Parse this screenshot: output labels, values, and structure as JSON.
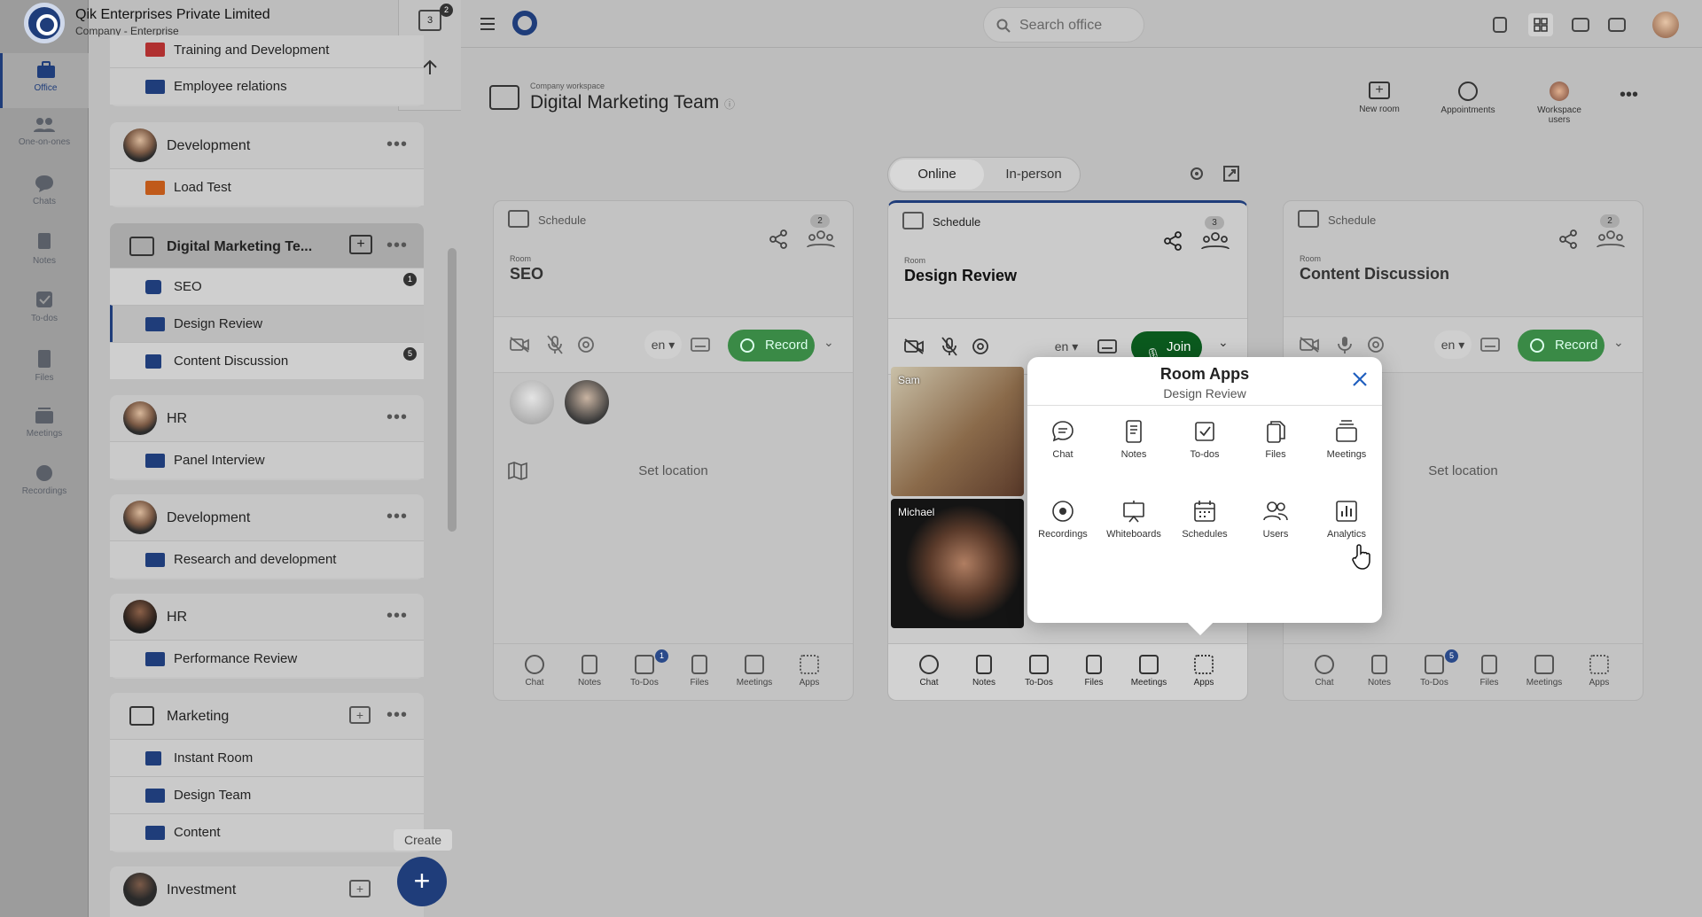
{
  "company": {
    "name": "Qik Enterprises Private Limited",
    "subtitle": "Company - Enterprise"
  },
  "rail": [
    {
      "label": "Office",
      "icon": "briefcase-icon",
      "active": true
    },
    {
      "label": "One-on-ones",
      "icon": "people-icon"
    },
    {
      "label": "Chats",
      "icon": "chat-icon"
    },
    {
      "label": "Notes",
      "icon": "notes-icon"
    },
    {
      "label": "To-dos",
      "icon": "todo-icon"
    },
    {
      "label": "Files",
      "icon": "files-icon"
    },
    {
      "label": "Meetings",
      "icon": "meetings-icon"
    },
    {
      "label": "Recordings",
      "icon": "recordings-icon"
    }
  ],
  "calendar": {
    "day": "3",
    "badge": "2"
  },
  "search": {
    "placeholder": "Search office"
  },
  "sidebar": {
    "groups": [
      {
        "rows": [
          "Training and Development",
          "Employee relations"
        ]
      },
      {
        "title": "Development",
        "rows": [
          "Load Test"
        ]
      },
      {
        "title": "Digital Marketing Te...",
        "rows": [
          "SEO",
          "Design Review",
          "Content Discussion"
        ]
      },
      {
        "title": "HR",
        "rows": [
          "Panel Interview"
        ]
      },
      {
        "title": "Development",
        "rows": [
          "Research and development"
        ]
      },
      {
        "title": "HR",
        "rows": [
          "Performance Review"
        ]
      },
      {
        "title": "Marketing",
        "rows": [
          "Instant Room",
          "Design Team",
          "Content"
        ]
      },
      {
        "title": "Investment",
        "rows": []
      }
    ],
    "badges": {
      "seo": "1",
      "content": "5"
    }
  },
  "workspace": {
    "caption": "Company workspace",
    "name": "Digital Marketing Team"
  },
  "toolbar": {
    "new_room": "New room",
    "appointments": "Appointments",
    "workspace_users": "Workspace users"
  },
  "mode_toggle": {
    "online": "Online",
    "in_person": "In-person"
  },
  "rooms": [
    {
      "schedule": "Schedule",
      "count": "2",
      "caption": "Room",
      "name": "SEO",
      "lang": "en",
      "action": "Record",
      "location": "Set location",
      "todo_badge": "1"
    },
    {
      "schedule": "Schedule",
      "count": "3",
      "caption": "Room",
      "name": "Design Review",
      "lang": "en",
      "action": "Join",
      "participants": [
        "Sam",
        "Michael"
      ]
    },
    {
      "schedule": "Schedule",
      "count": "2",
      "caption": "Room",
      "name": "Content Discussion",
      "lang": "en",
      "action": "Record",
      "location": "Set location",
      "todo_badge": "5"
    }
  ],
  "room_bar": [
    "Chat",
    "Notes",
    "To-Dos",
    "Files",
    "Meetings",
    "Apps"
  ],
  "modal": {
    "title": "Room Apps",
    "subtitle": "Design Review",
    "apps": [
      {
        "label": "Chat",
        "icon": "chat-icon"
      },
      {
        "label": "Notes",
        "icon": "notes-icon"
      },
      {
        "label": "To-dos",
        "icon": "todo-icon"
      },
      {
        "label": "Files",
        "icon": "files-icon"
      },
      {
        "label": "Meetings",
        "icon": "meetings-icon"
      },
      {
        "label": "Recordings",
        "icon": "recordings-icon"
      },
      {
        "label": "Whiteboards",
        "icon": "whiteboard-icon"
      },
      {
        "label": "Schedules",
        "icon": "calendar-icon"
      },
      {
        "label": "Users",
        "icon": "users-icon"
      },
      {
        "label": "Analytics",
        "icon": "analytics-icon"
      }
    ]
  },
  "fab": {
    "tooltip": "Create",
    "symbol": "+"
  }
}
